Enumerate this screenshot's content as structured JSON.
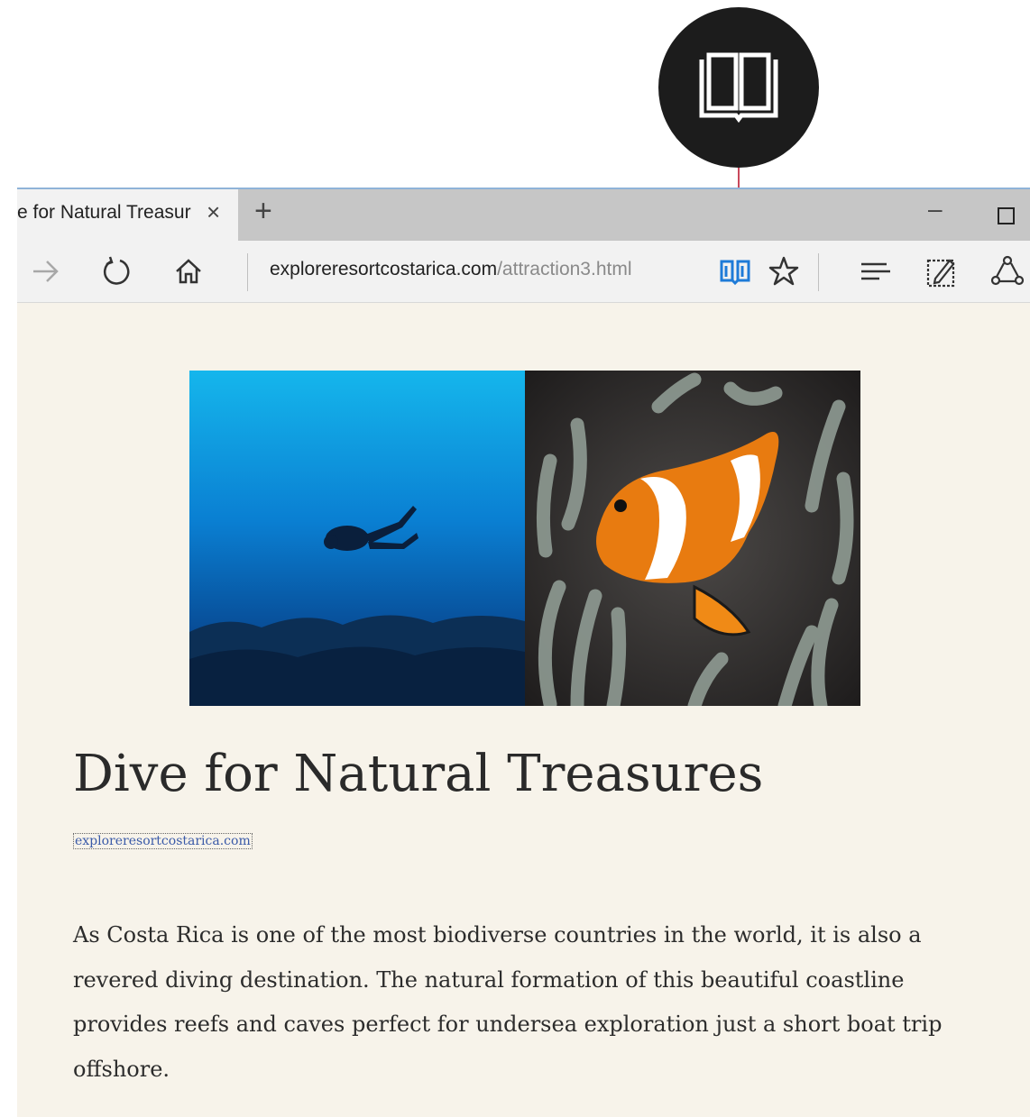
{
  "browser": {
    "tab_title": "e for Natural Treasur",
    "close_glyph": "×",
    "new_tab_glyph": "+",
    "minimize_glyph": "–",
    "address_domain": "exploreresortcostarica.com",
    "address_path": "/attraction3.html"
  },
  "icons": {
    "callout": "reading-view-icon",
    "forward": "forward-arrow-icon",
    "refresh": "refresh-icon",
    "home": "home-icon",
    "reading_view": "reading-view-icon",
    "favorite": "star-icon",
    "hub": "hub-icon",
    "web_note": "web-note-icon",
    "share": "share-icon"
  },
  "colors": {
    "reading_accent": "#1e7bd8",
    "callout_line": "#c9485b",
    "reading_background": "#f7f3ea"
  },
  "article": {
    "title": "Dive for Natural Treasures",
    "source": "exploreresortcostarica.com",
    "paragraph": "As Costa Rica is one of the most biodiverse countries in the world, it is also a revered diving destination. The natural formation of this beautiful coastline provides reefs and caves perfect for undersea exploration just a short boat trip offshore."
  }
}
